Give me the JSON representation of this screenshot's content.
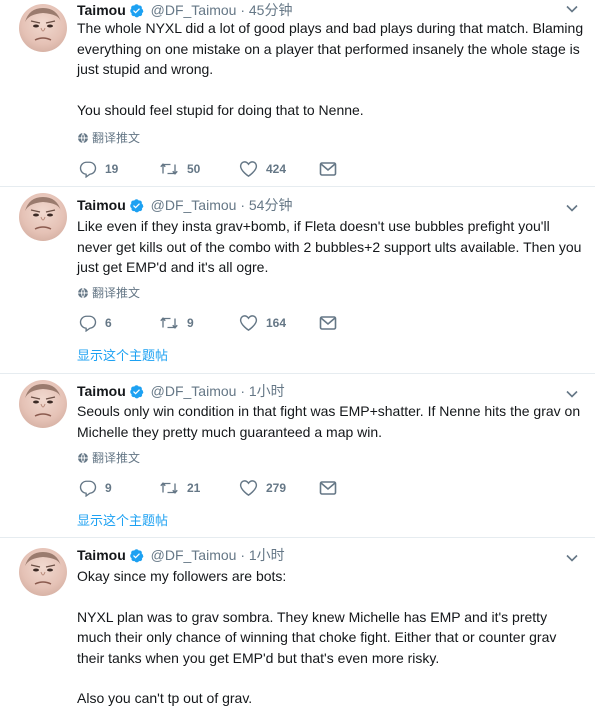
{
  "colors": {
    "accent": "#1da1f2",
    "muted": "#657786",
    "text": "#14171a",
    "divider": "#e6ecf0"
  },
  "icons": {
    "reply": "reply-icon",
    "retweet": "retweet-icon",
    "like": "heart-icon",
    "dm": "envelope-icon",
    "verified": "verified-badge-icon",
    "translate": "globe-icon",
    "menu": "chevron-down-icon"
  },
  "tweets": [
    {
      "name": "Taimou",
      "handle": "@DF_Taimou",
      "sep": "·",
      "time": "45分钟",
      "text": [
        "The whole NYXL did a lot of good plays and bad plays during that match. Blaming everything on one mistake on a player that performed insanely the whole stage is just stupid and wrong.",
        "You should feel stupid for doing that to Nenne."
      ],
      "translate": "翻译推文",
      "replies": "19",
      "retweets": "50",
      "likes": "424"
    },
    {
      "name": "Taimou",
      "handle": "@DF_Taimou",
      "sep": "·",
      "time": "54分钟",
      "text": [
        "Like even if they insta grav+bomb, if Fleta doesn't use bubbles prefight you'll never get kills out of the combo with 2 bubbles+2 support ults available. Then you just get EMP'd and it's all ogre."
      ],
      "translate": "翻译推文",
      "replies": "6",
      "retweets": "9",
      "likes": "164",
      "thread": "显示这个主题帖"
    },
    {
      "name": "Taimou",
      "handle": "@DF_Taimou",
      "sep": "·",
      "time": "1小时",
      "text": [
        "Seouls only win condition in that fight was EMP+shatter. If Nenne hits the grav on Michelle they pretty much guaranteed a map win."
      ],
      "translate": "翻译推文",
      "replies": "9",
      "retweets": "21",
      "likes": "279",
      "thread": "显示这个主题帖"
    },
    {
      "name": "Taimou",
      "handle": "@DF_Taimou",
      "sep": "·",
      "time": "1小时",
      "text": [
        "Okay since my followers are bots:",
        "NYXL plan was to grav sombra. They knew Michelle has  EMP and it's pretty much their only chance of winning that choke fight. Either that or counter grav their tanks when you get EMP'd but that's even more risky.",
        "Also you can't tp out of grav."
      ]
    }
  ]
}
